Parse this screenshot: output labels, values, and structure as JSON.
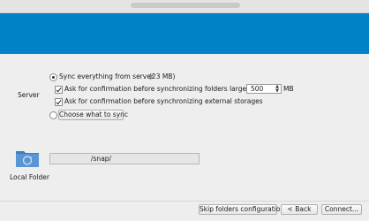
{
  "server": {
    "label": "Server",
    "sync_everything": {
      "label": "Sync everything from server",
      "size": "(23 MB)",
      "selected": true
    },
    "ask_large_folders": {
      "label": "Ask for confirmation before synchronizing folders larger than",
      "checked": true,
      "value": "500",
      "unit": "MB"
    },
    "ask_external": {
      "label": "Ask for confirmation before synchronizing external storages",
      "checked": true
    },
    "choose_what_to_sync": {
      "label": "Choose what to sync",
      "selected": false
    }
  },
  "local_folder": {
    "label": "Local Folder",
    "path": "/snap/",
    "icon": "folder-sync-icon"
  },
  "footer": {
    "skip_label": "Skip folders configuration",
    "back_label": "< Back",
    "connect_label": "Connect..."
  },
  "colors": {
    "banner": "#0082c8"
  }
}
